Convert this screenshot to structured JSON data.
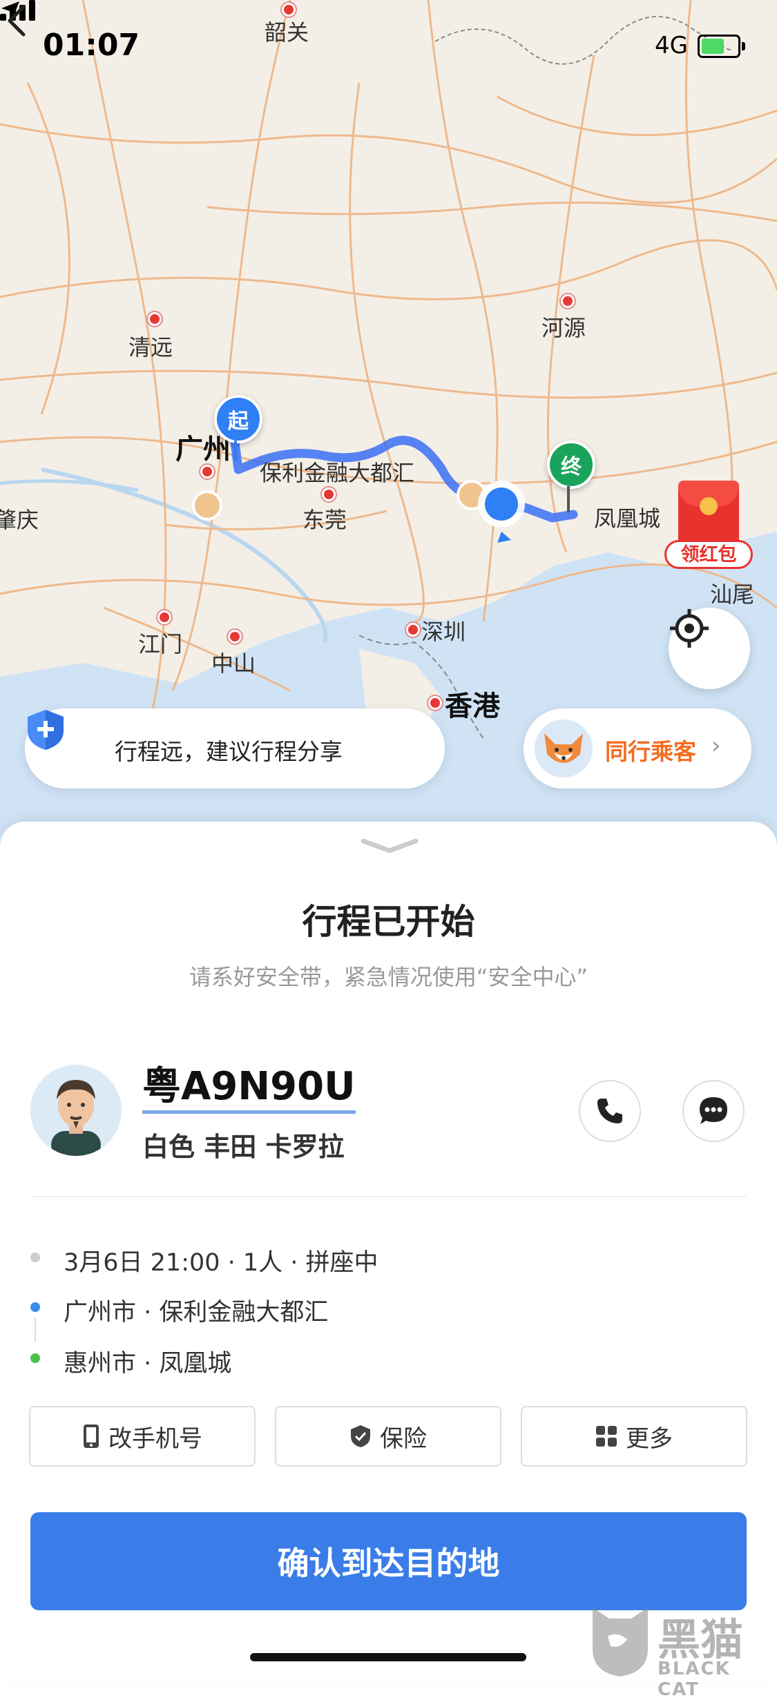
{
  "status_bar": {
    "time": "01:07",
    "network": "4G"
  },
  "map": {
    "cities": {
      "shaoguan": "韶关",
      "qingyuan": "清远",
      "heyuan": "河源",
      "guangzhou": "广州",
      "poly": "保利金融大都汇",
      "zhaoqing": "肇庆",
      "dongguan": "东莞",
      "fenghuangcheng": "凤凰城",
      "shanwei": "汕尾",
      "jiangmen": "江门",
      "zhongshan": "中山",
      "shenzhen": "深圳",
      "hongkong": "香港"
    },
    "start_marker": "起",
    "end_marker": "终",
    "red_packet_label": "领红包",
    "share_hint": "行程远，建议行程分享",
    "copassenger_label": "同行乘客",
    "copassenger_chevron": "›"
  },
  "trip": {
    "title": "行程已开始",
    "subtitle": "请系好安全带，紧急情况使用“安全中心”",
    "plate": "粤A9N90U",
    "car": "白色 丰田 卡罗拉",
    "meta": "3月6日 21:00 · 1人 · 拼座中",
    "from": "广州市 · 保利金融大都汇",
    "to": "惠州市 · 凤凰城"
  },
  "actions": {
    "change_phone": "改手机号",
    "insurance": "保险",
    "more": "更多"
  },
  "confirm_label": "确认到达目的地",
  "watermark": {
    "cn": "黑猫",
    "en": "BLACK CAT"
  },
  "colors": {
    "primary_blue": "#3a7de8",
    "start_blue": "#2f7ff5",
    "end_green": "#1aa35a",
    "copassenger_orange": "#f36c21",
    "red_packet": "#e9322e"
  }
}
